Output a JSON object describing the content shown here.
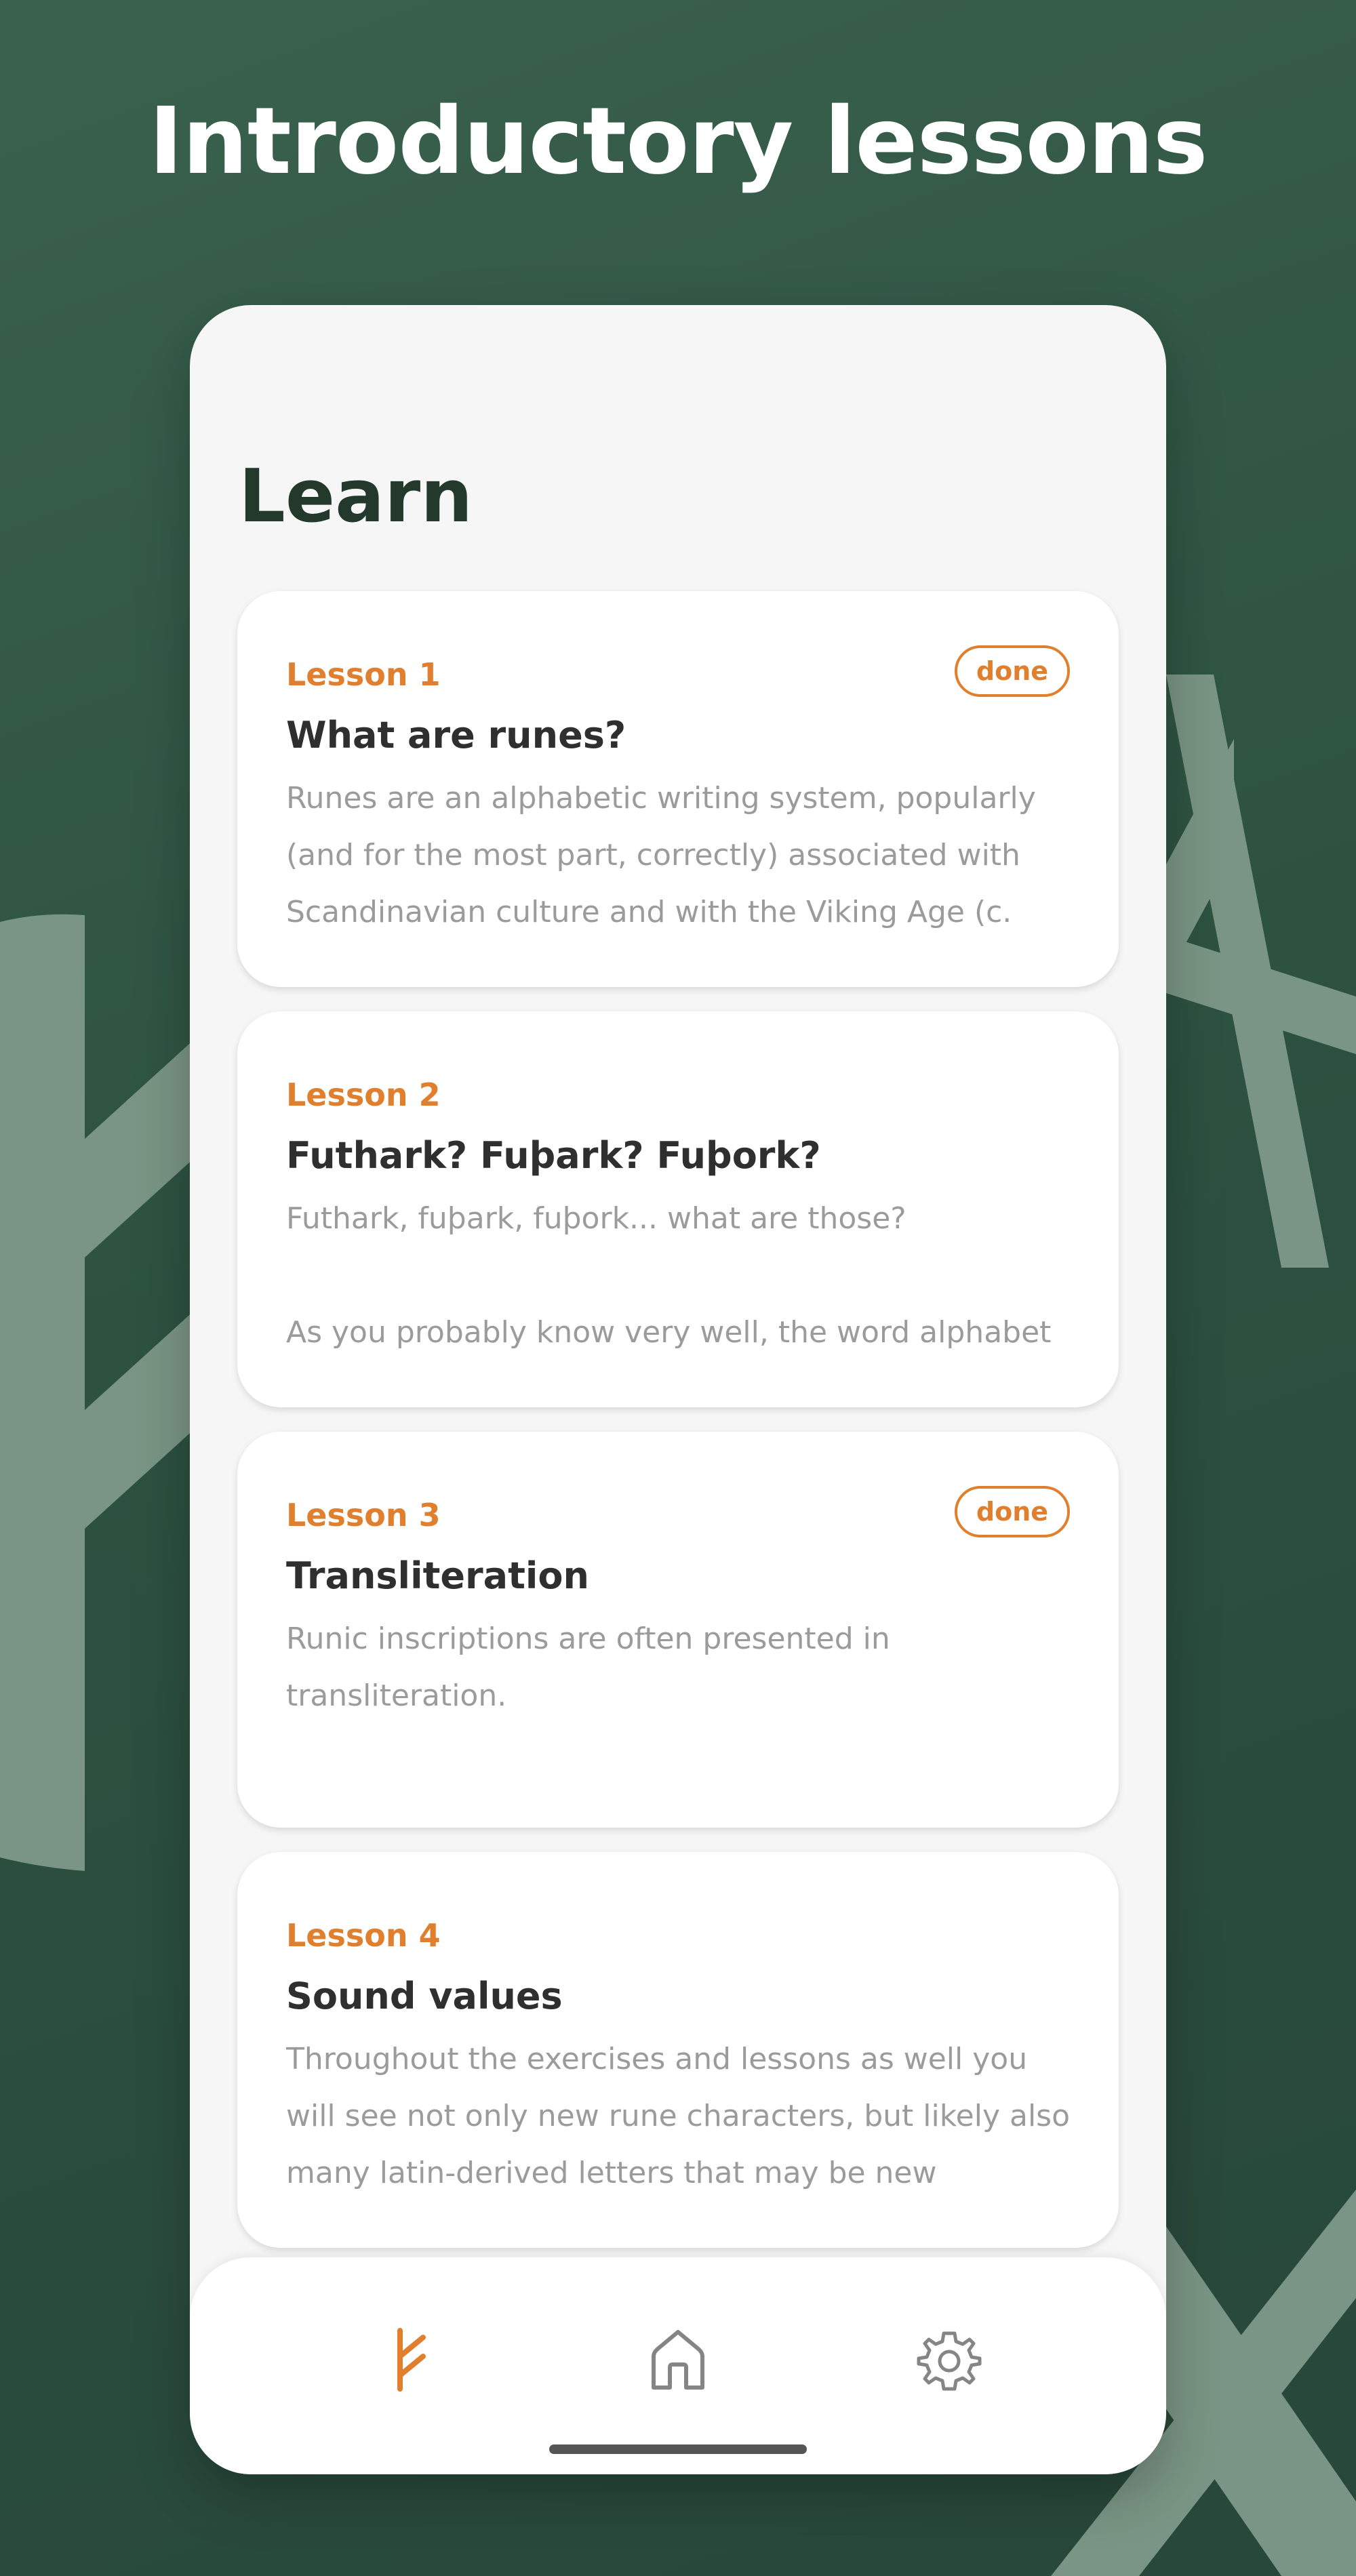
{
  "headline": "Introductory lessons",
  "screen": {
    "title": "Learn"
  },
  "lessons": [
    {
      "number": "Lesson 1",
      "title": "What are runes?",
      "excerpt": "Runes are an alphabetic writing system, popularly (and for the most part, correctly) associated with Scandinavian culture and with the Viking Age (c.",
      "badge": "done"
    },
    {
      "number": "Lesson 2",
      "title": "Futhark? Fuþark? Fuþork?",
      "excerpt": "Futhark, fuþark, fuþork... what are those?\n\nAs you probably know very well, the word alphabet",
      "badge": ""
    },
    {
      "number": "Lesson 3",
      "title": "Transliteration",
      "excerpt": "Runic inscriptions are often presented in transliteration.",
      "badge": "done"
    },
    {
      "number": "Lesson 4",
      "title": "Sound values",
      "excerpt": "Throughout the exercises and lessons as well you will see not only new rune characters, but likely also many latin-derived letters that may be new",
      "badge": ""
    }
  ],
  "nav": {
    "items": [
      {
        "icon": "rune-fehu-icon",
        "active": true
      },
      {
        "icon": "home-icon",
        "active": false
      },
      {
        "icon": "settings-gear-icon",
        "active": false
      }
    ]
  },
  "colors": {
    "background": "#2d5240",
    "accent": "#e07f2d",
    "title_text": "#22392c",
    "body_text": "#9b9b9b",
    "rune_decoration": "#7a9585"
  }
}
